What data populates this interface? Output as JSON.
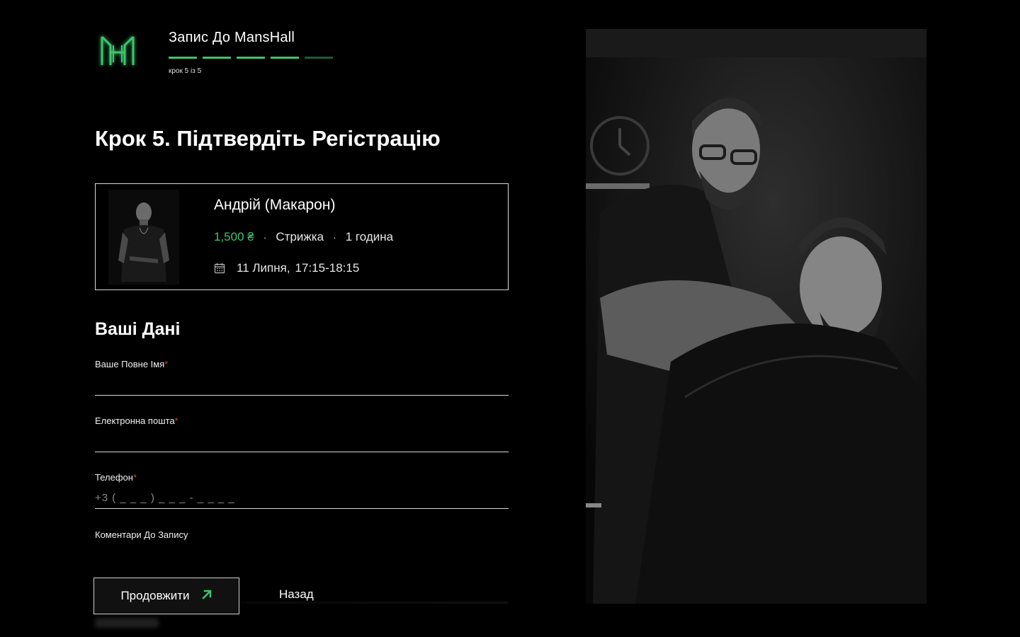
{
  "header": {
    "app_title": "Запис До MansHall",
    "step_counter": "крок 5 із 5",
    "progress": {
      "current": 5,
      "total": 5
    }
  },
  "page_title": "Крок 5. Підтвердіть Регістрацію",
  "booking": {
    "barber_name": "Андрій (Макарон)",
    "price": "1,500 ₴",
    "service": "Стрижка",
    "duration": "1 година",
    "date": "11 Липня,",
    "time": "17:15-18:15"
  },
  "form": {
    "section_title": "Ваші Дані",
    "full_name_label": "Ваше Повне Імя",
    "email_label": "Електронна пошта",
    "phone_label": "Телефон",
    "phone_placeholder": "+3 ( _ _ _ ) _ _ _ - _ _ _ _",
    "comment_label": "Коментари До Запису",
    "required_mark": "*"
  },
  "buttons": {
    "continue_label": "Продовжити",
    "back_label": "Назад"
  },
  "colors": {
    "accent": "#3ec46d",
    "accent_dim": "#1e5a36",
    "required": "#e23b3b",
    "background": "#000000"
  },
  "icons": {
    "logo": "mansHall-logo",
    "calendar": "calendar-icon",
    "arrow": "arrow-up-right-icon"
  }
}
